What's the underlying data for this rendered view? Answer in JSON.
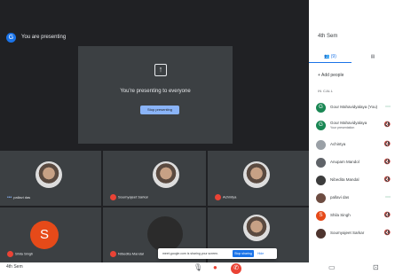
{
  "header": {
    "avatar_letter": "G",
    "presenting_label": "You are presenting"
  },
  "presentation": {
    "icon": "present-to-all-icon",
    "message": "You're presenting to everyone",
    "stop_label": "Stop presenting"
  },
  "tiles": [
    {
      "name": "pallavi das",
      "icon": "more-dots-icon"
    },
    {
      "name": "Soumyajeet Sarkar",
      "icon": "mic-off-icon"
    },
    {
      "name": "Achintya",
      "icon": "mic-off-icon"
    },
    {
      "name": "Shila Singh",
      "icon": "mic-off-icon",
      "avatar_letter": "S"
    },
    {
      "name": "Nibedita Mandal",
      "icon": "mic-off-icon"
    },
    {
      "name": "",
      "icon": ""
    }
  ],
  "toast": {
    "message": "meet.google.com is sharing your screen.",
    "stop_label": "Stop sharing",
    "hide_label": "Hide"
  },
  "bottom": {
    "meeting_name": "4th Sem"
  },
  "sidebar": {
    "title": "4th Sem",
    "tabs": [
      {
        "label": "(9)",
        "icon": "people-icon"
      },
      {
        "label": "",
        "icon": "chat-icon"
      }
    ],
    "add_people": "Add people",
    "in_call_label": "IN CALL",
    "participants": [
      {
        "name": "Gour Mahavidyalaya (You)",
        "sub": "",
        "avatar": "G",
        "color": "#1a8754"
      },
      {
        "name": "Gour Mahavidyalaya",
        "sub": "Your presentation",
        "avatar": "G",
        "color": "#1a8754"
      },
      {
        "name": "Achintya",
        "sub": "",
        "avatar": "",
        "color": "#9aa0a6"
      },
      {
        "name": "Anupam Mandol",
        "sub": "",
        "avatar": "",
        "color": "#5f6368"
      },
      {
        "name": "Nibedita Mandal",
        "sub": "",
        "avatar": "",
        "color": "#3c3c3c"
      },
      {
        "name": "pallavi das",
        "sub": "",
        "avatar": "",
        "color": "#6d4c41"
      },
      {
        "name": "Shila Singh",
        "sub": "",
        "avatar": "S",
        "color": "#e64a19"
      },
      {
        "name": "Soumyajeet Sarkar",
        "sub": "",
        "avatar": "",
        "color": "#4e342e"
      }
    ]
  }
}
